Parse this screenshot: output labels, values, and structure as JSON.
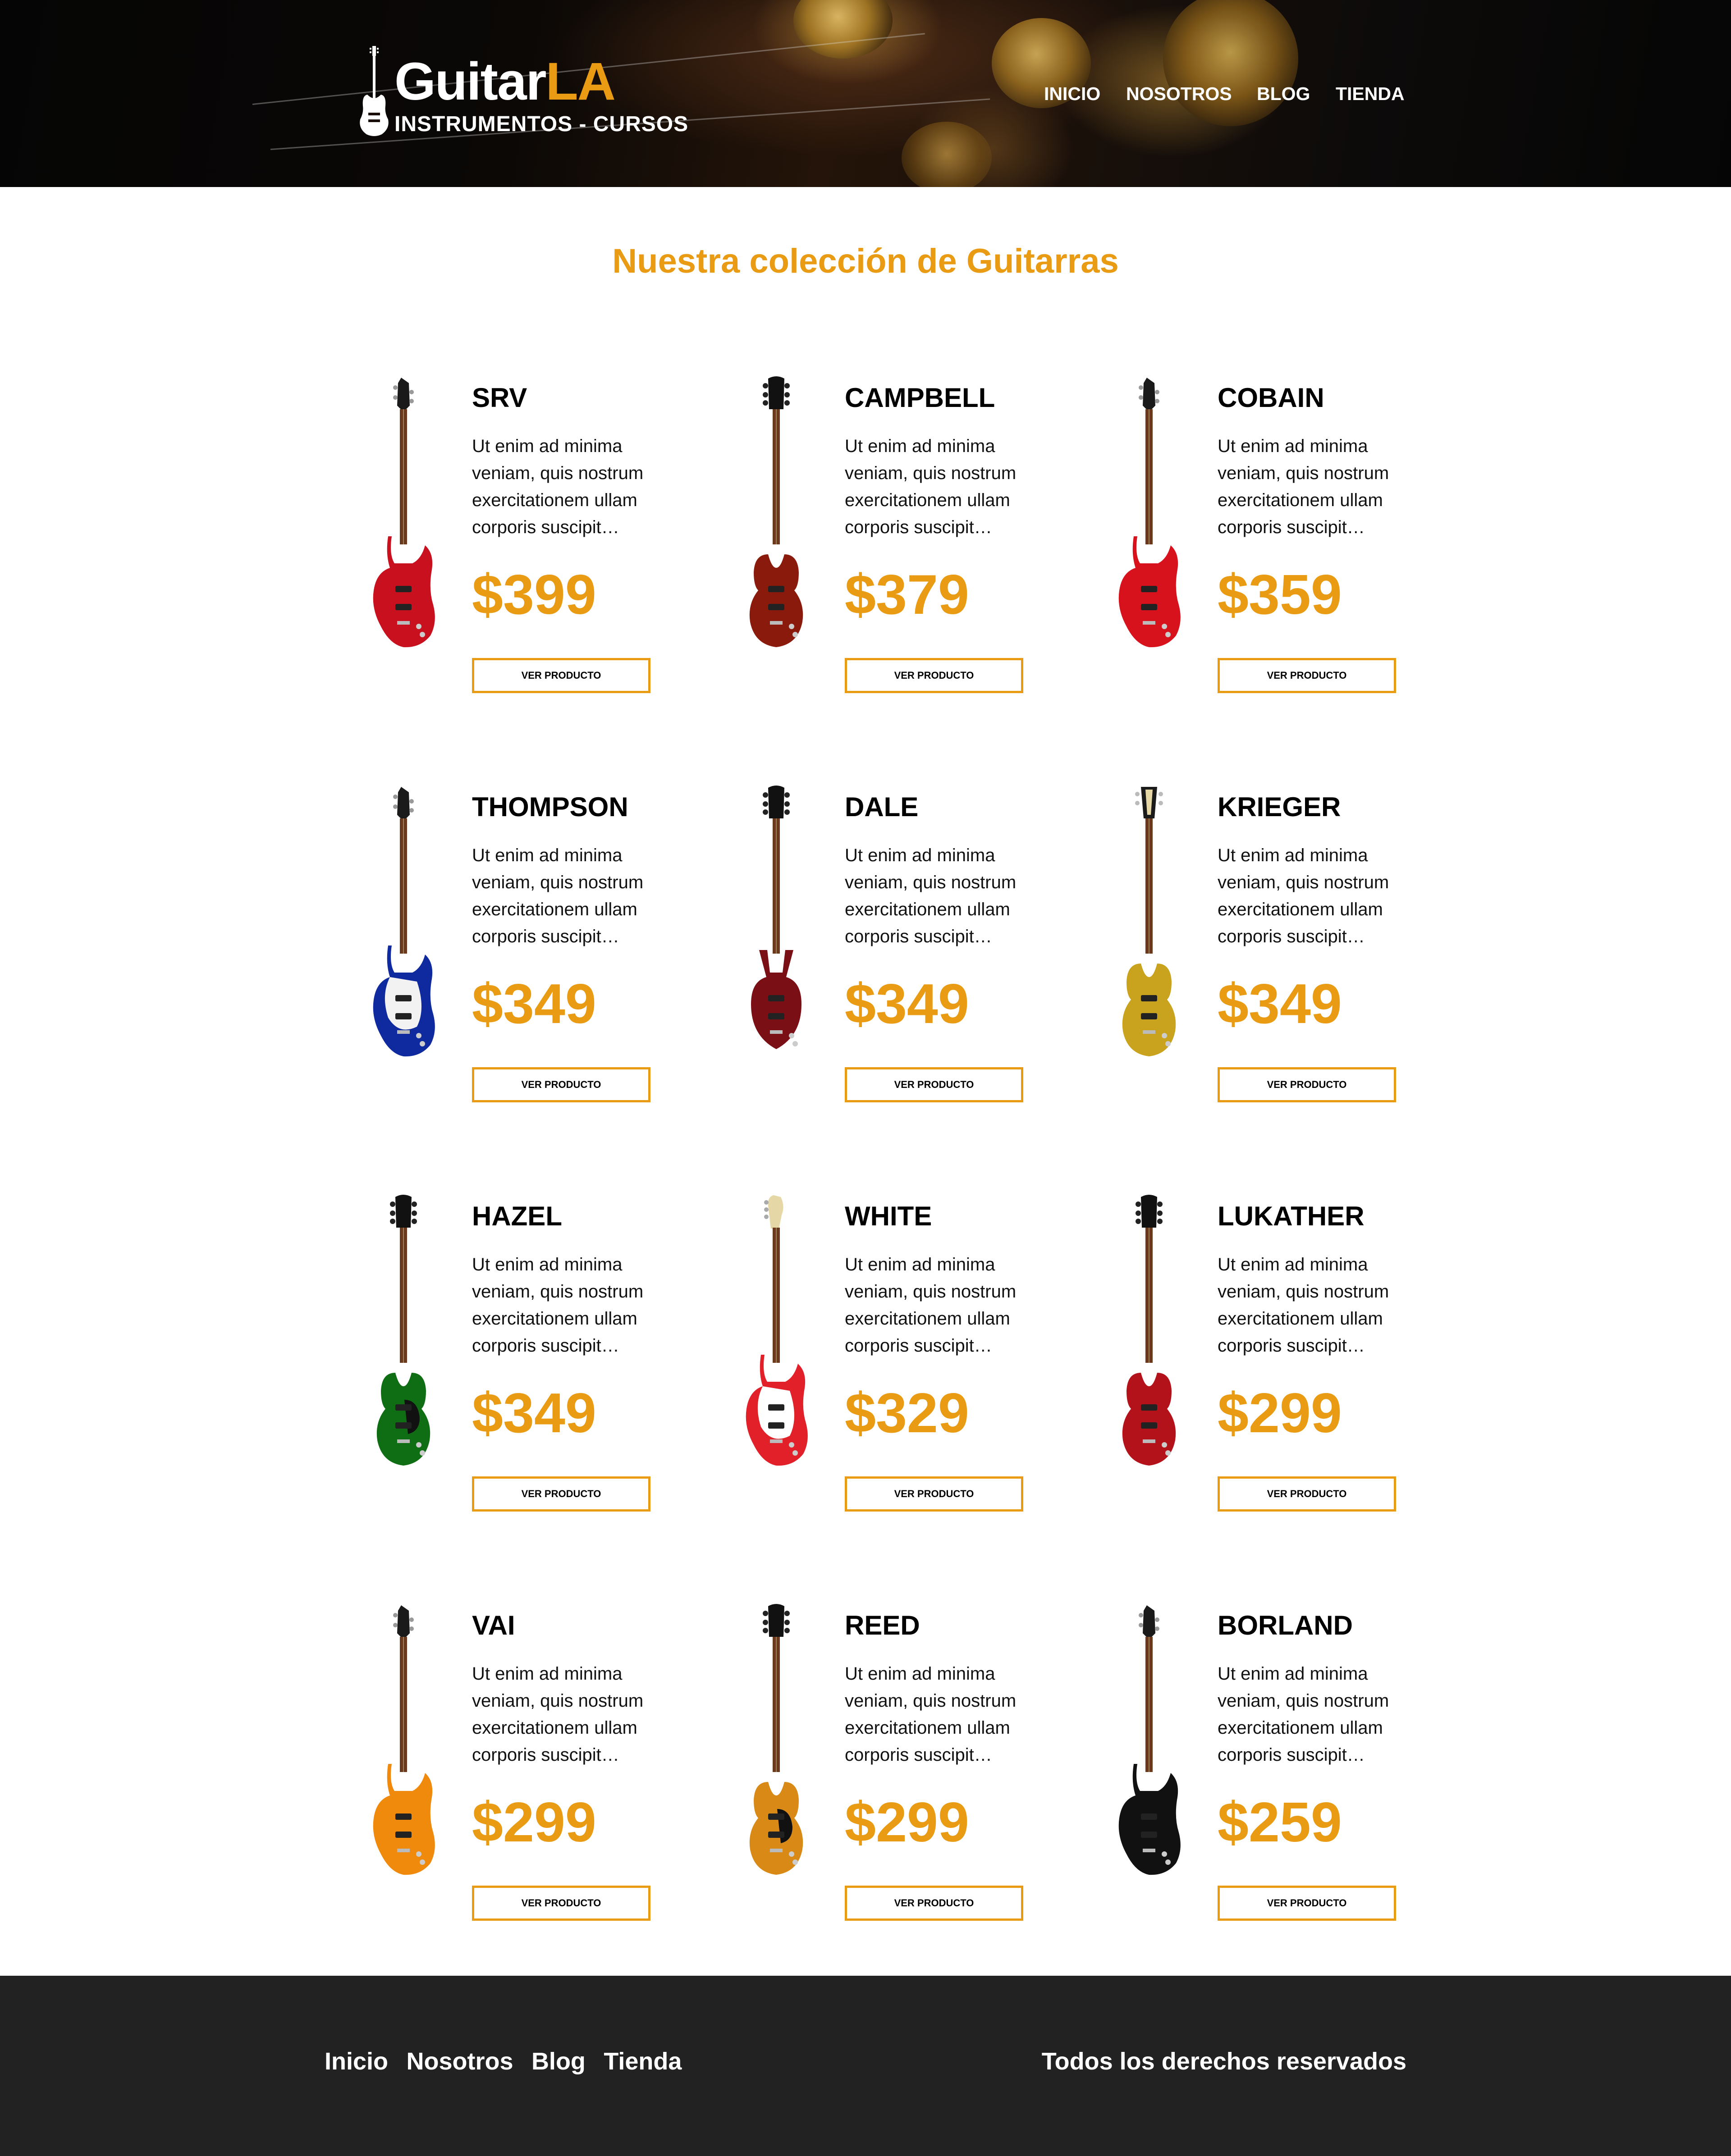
{
  "header": {
    "logo": {
      "word_main": "Guitar",
      "word_accent": "LA",
      "tagline": "INSTRUMENTOS - CURSOS"
    },
    "nav": [
      "INICIO",
      "NOSOTROS",
      "BLOG",
      "TIENDA"
    ]
  },
  "main": {
    "title": "Nuestra colección de Guitarras",
    "button_label": "VER PRODUCTO",
    "description": "Ut enim ad minima veniam, quis nostrum exercitationem ullam corporis suscipit…",
    "guitars": [
      {
        "name": "SRV",
        "price": "$399",
        "body_color": "#c8101e",
        "pickguard": "none",
        "headstock": "pointed",
        "style": "strat"
      },
      {
        "name": "CAMPBELL",
        "price": "$379",
        "body_color": "#8a1a0c",
        "pickguard": "none",
        "headstock": "lp",
        "style": "lp"
      },
      {
        "name": "COBAIN",
        "price": "$359",
        "body_color": "#d8121c",
        "pickguard": "none",
        "headstock": "pointed",
        "style": "strat"
      },
      {
        "name": "THOMPSON",
        "price": "$349",
        "body_color": "#0f2a9e",
        "pickguard": "#f2f2f2",
        "headstock": "pointed",
        "style": "strat"
      },
      {
        "name": "DALE",
        "price": "$349",
        "body_color": "#7a0f16",
        "pickguard": "none",
        "headstock": "lp",
        "style": "sg"
      },
      {
        "name": "KRIEGER",
        "price": "$349",
        "body_color": "#c9a21e",
        "pickguard": "none",
        "headstock": "open",
        "style": "lp"
      },
      {
        "name": "HAZEL",
        "price": "$349",
        "body_color": "#0f6e14",
        "pickguard": "#111111",
        "headstock": "lp",
        "style": "lp"
      },
      {
        "name": "WHITE",
        "price": "$329",
        "body_color": "#e2202a",
        "pickguard": "#ffffff",
        "headstock": "tele",
        "style": "tele"
      },
      {
        "name": "LUKATHER",
        "price": "$299",
        "body_color": "#b4121a",
        "pickguard": "none",
        "headstock": "lp",
        "style": "lp"
      },
      {
        "name": "VAI",
        "price": "$299",
        "body_color": "#f08a0c",
        "pickguard": "none",
        "headstock": "pointed",
        "style": "strat"
      },
      {
        "name": "REED",
        "price": "$299",
        "body_color": "#d98a16",
        "pickguard": "#111111",
        "headstock": "lp",
        "style": "lp"
      },
      {
        "name": "BORLAND",
        "price": "$259",
        "body_color": "#111111",
        "pickguard": "none",
        "headstock": "pointed",
        "style": "strat"
      }
    ]
  },
  "footer": {
    "nav": [
      "Inicio",
      "Nosotros",
      "Blog",
      "Tienda"
    ],
    "copyright": "Todos los derechos reservados"
  },
  "colors": {
    "accent": "#e99b14",
    "footer_bg": "#222222",
    "header_bg": "#0b0806"
  }
}
